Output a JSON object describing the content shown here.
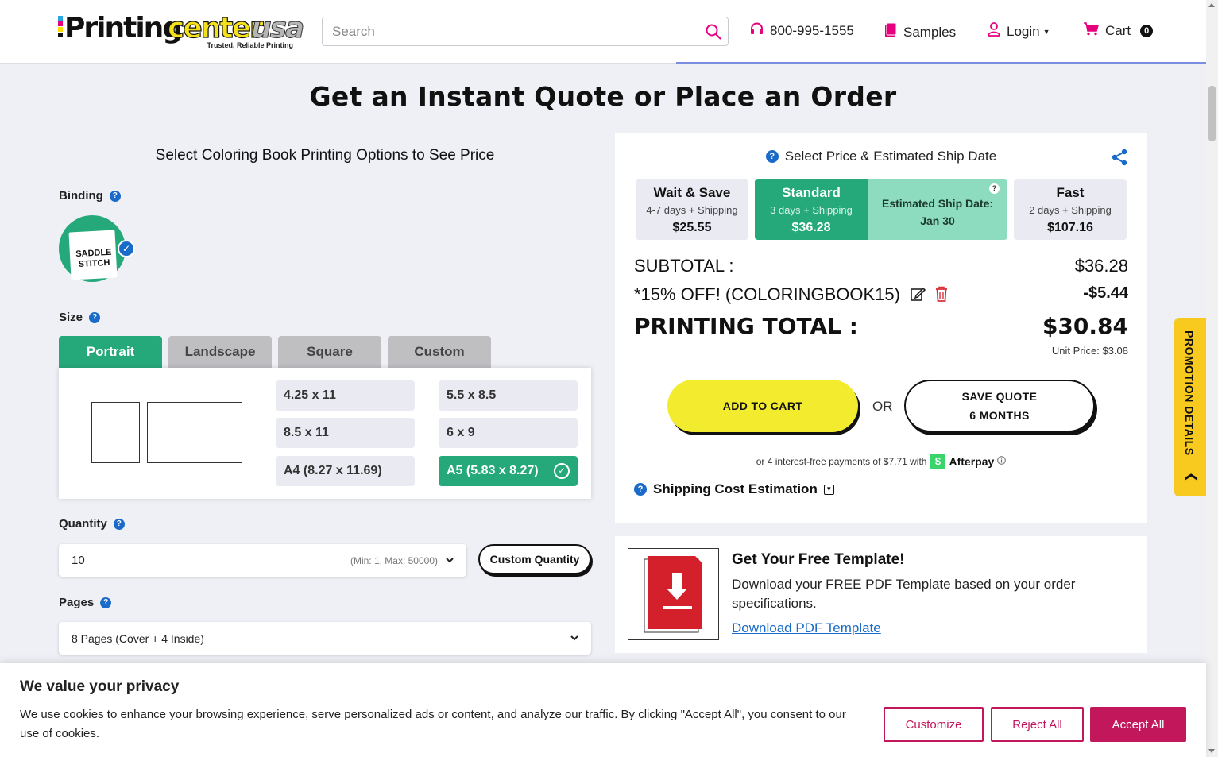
{
  "header": {
    "logo": {
      "part1": "Printing",
      "part2": "center",
      "part3": "usa",
      "tagline": "Trusted, Reliable Printing"
    },
    "search_placeholder": "Search",
    "phone": "800-995-1555",
    "samples": "Samples",
    "login": "Login",
    "cart": "Cart",
    "cart_count": "0"
  },
  "page_title": "Get an Instant Quote or Place an Order",
  "options": {
    "subtitle": "Select Coloring Book Printing Options to See Price",
    "binding_label": "Binding",
    "binding_selected": "SADDLE STITCH",
    "size_label": "Size",
    "size_tabs": [
      "Portrait",
      "Landscape",
      "Square",
      "Custom"
    ],
    "sizes": [
      "4.25 x 11",
      "5.5 x 8.5",
      "8.5 x 11",
      "6 x 9",
      "A4 (8.27 x 11.69)",
      "A5 (5.83 x 8.27)"
    ],
    "quantity_label": "Quantity",
    "quantity_value": "10",
    "quantity_range": "(Min: 1, Max: 50000)",
    "custom_quantity": "Custom Quantity",
    "pages_label": "Pages",
    "pages_value": "8 Pages (Cover + 4 Inside)"
  },
  "pricing": {
    "heading": "Select Price & Estimated Ship Date",
    "wait": {
      "name": "Wait & Save",
      "days": "4-7 days + Shipping",
      "price": "$25.55"
    },
    "standard": {
      "name": "Standard",
      "days": "3 days + Shipping",
      "price": "$36.28"
    },
    "estimate_line1": "Estimated Ship Date:",
    "estimate_line2": "Jan 30",
    "fast": {
      "name": "Fast",
      "days": "2 days + Shipping",
      "price": "$107.16"
    },
    "subtotal_label": "SUBTOTAL :",
    "subtotal": "$36.28",
    "discount_label": "*15% OFF! (COLORINGBOOK15)",
    "discount": "-$5.44",
    "total_label": "PRINTING TOTAL :",
    "total": "$30.84",
    "unit_price": "Unit Price: $3.08",
    "add_to_cart": "ADD TO CART",
    "or": "OR",
    "save_quote_1": "SAVE QUOTE",
    "save_quote_2": "6 MONTHS",
    "afterpay_text": "or 4 interest-free payments of $7.71 with",
    "afterpay_name": "Afterpay",
    "shipping": "Shipping Cost Estimation"
  },
  "template": {
    "title": "Get Your Free Template!",
    "desc": "Download your FREE PDF Template based on your order specifications.",
    "link": "Download PDF Template"
  },
  "promo": "PROMOTION DETAILS",
  "cookie": {
    "title": "We value your privacy",
    "body": "We use cookies to enhance your browsing experience, serve personalized ads or content, and analyze our traffic. By clicking \"Accept All\", you consent to our use of cookies.",
    "customize": "Customize",
    "reject": "Reject All",
    "accept": "Accept All"
  },
  "colors": {
    "accent": "#26a97a",
    "yellow": "#f3ec2e",
    "cookie": "#c2185b",
    "blue": "#1a6bc9"
  }
}
